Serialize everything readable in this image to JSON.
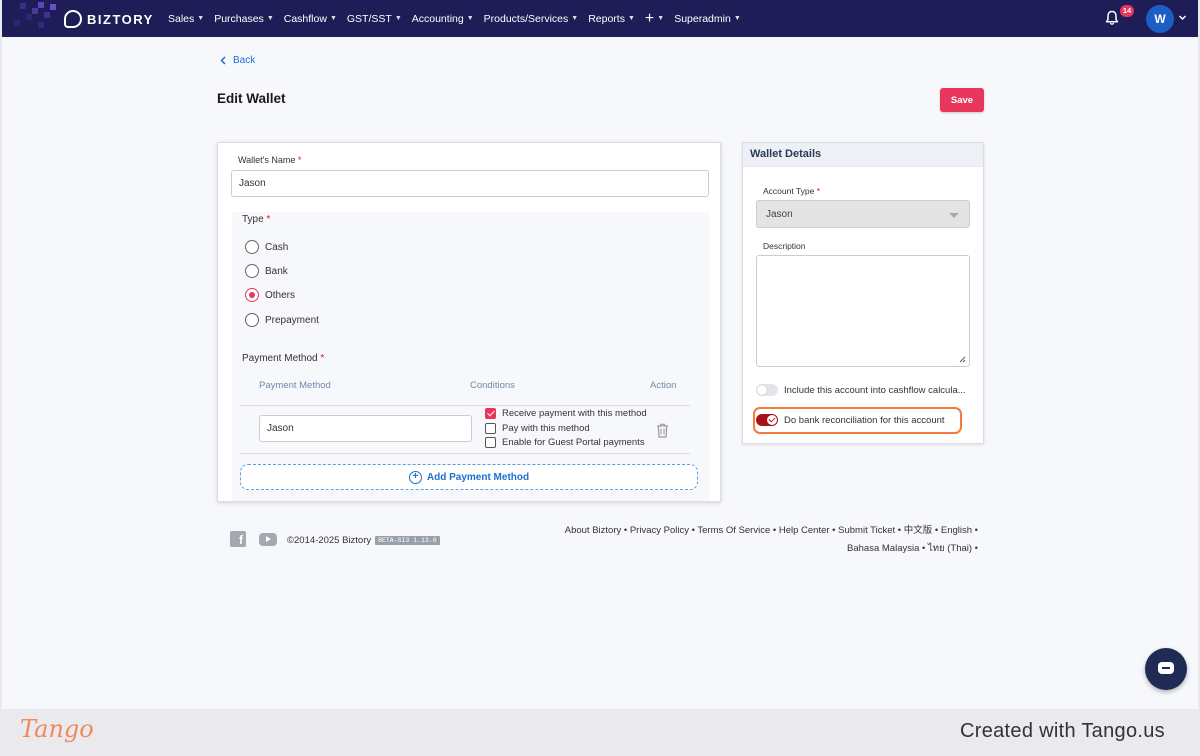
{
  "nav": {
    "brand": "BIZTORY",
    "items": [
      {
        "label": "Sales"
      },
      {
        "label": "Purchases"
      },
      {
        "label": "Cashflow"
      },
      {
        "label": "GST/SST"
      },
      {
        "label": "Accounting"
      },
      {
        "label": "Products/Services"
      },
      {
        "label": "Reports"
      }
    ],
    "plus_label": "+",
    "superadmin": "Superadmin",
    "notification_count": "14",
    "avatar_letter": "W"
  },
  "page": {
    "back_label": "Back",
    "title": "Edit Wallet",
    "save_label": "Save"
  },
  "form": {
    "wallet_name_label": "Wallet's Name",
    "required_mark": "*",
    "wallet_name_value": "Jason",
    "type_label": "Type",
    "type_options": [
      {
        "label": "Cash",
        "selected": false
      },
      {
        "label": "Bank",
        "selected": false
      },
      {
        "label": "Others",
        "selected": true
      },
      {
        "label": "Prepayment",
        "selected": false
      }
    ],
    "payment_method_label": "Payment Method",
    "columns": [
      "Payment Method",
      "Conditions",
      "Action"
    ],
    "payment_row": {
      "method_value": "Jason",
      "conditions": [
        {
          "label": "Receive payment with this method",
          "checked": true
        },
        {
          "label": "Pay with this method",
          "checked": false
        },
        {
          "label": "Enable for Guest Portal payments",
          "checked": false
        }
      ]
    },
    "add_payment_label": "Add Payment Method"
  },
  "wallet_details": {
    "title": "Wallet Details",
    "account_type_label": "Account Type",
    "account_type_value": "Jason",
    "description_label": "Description",
    "description_value": "",
    "include_cashflow_label": "Include this account into cashflow calcula...",
    "include_cashflow_on": false,
    "bank_reconciliation_label": "Do bank reconciliation for this account",
    "bank_reconciliation_on": true
  },
  "footer": {
    "copyright": "©2014-2025 Biztory",
    "version": "BETA-SI3 1.13.0",
    "links_line1": "About Biztory • Privacy Policy • Terms Of Service • Help Center • Submit Ticket • 中文版 • English •",
    "links_line2": "Bahasa Malaysia • ไทย (Thai) •"
  },
  "banner": {
    "logo": "Tango",
    "credit": "Created with Tango.us"
  },
  "colors": {
    "nav_bg": "#1f1d57",
    "accent": "#e8365d",
    "link": "#1f6fd1",
    "toggle_on": "#a8131a",
    "highlight": "#f07b3a"
  }
}
